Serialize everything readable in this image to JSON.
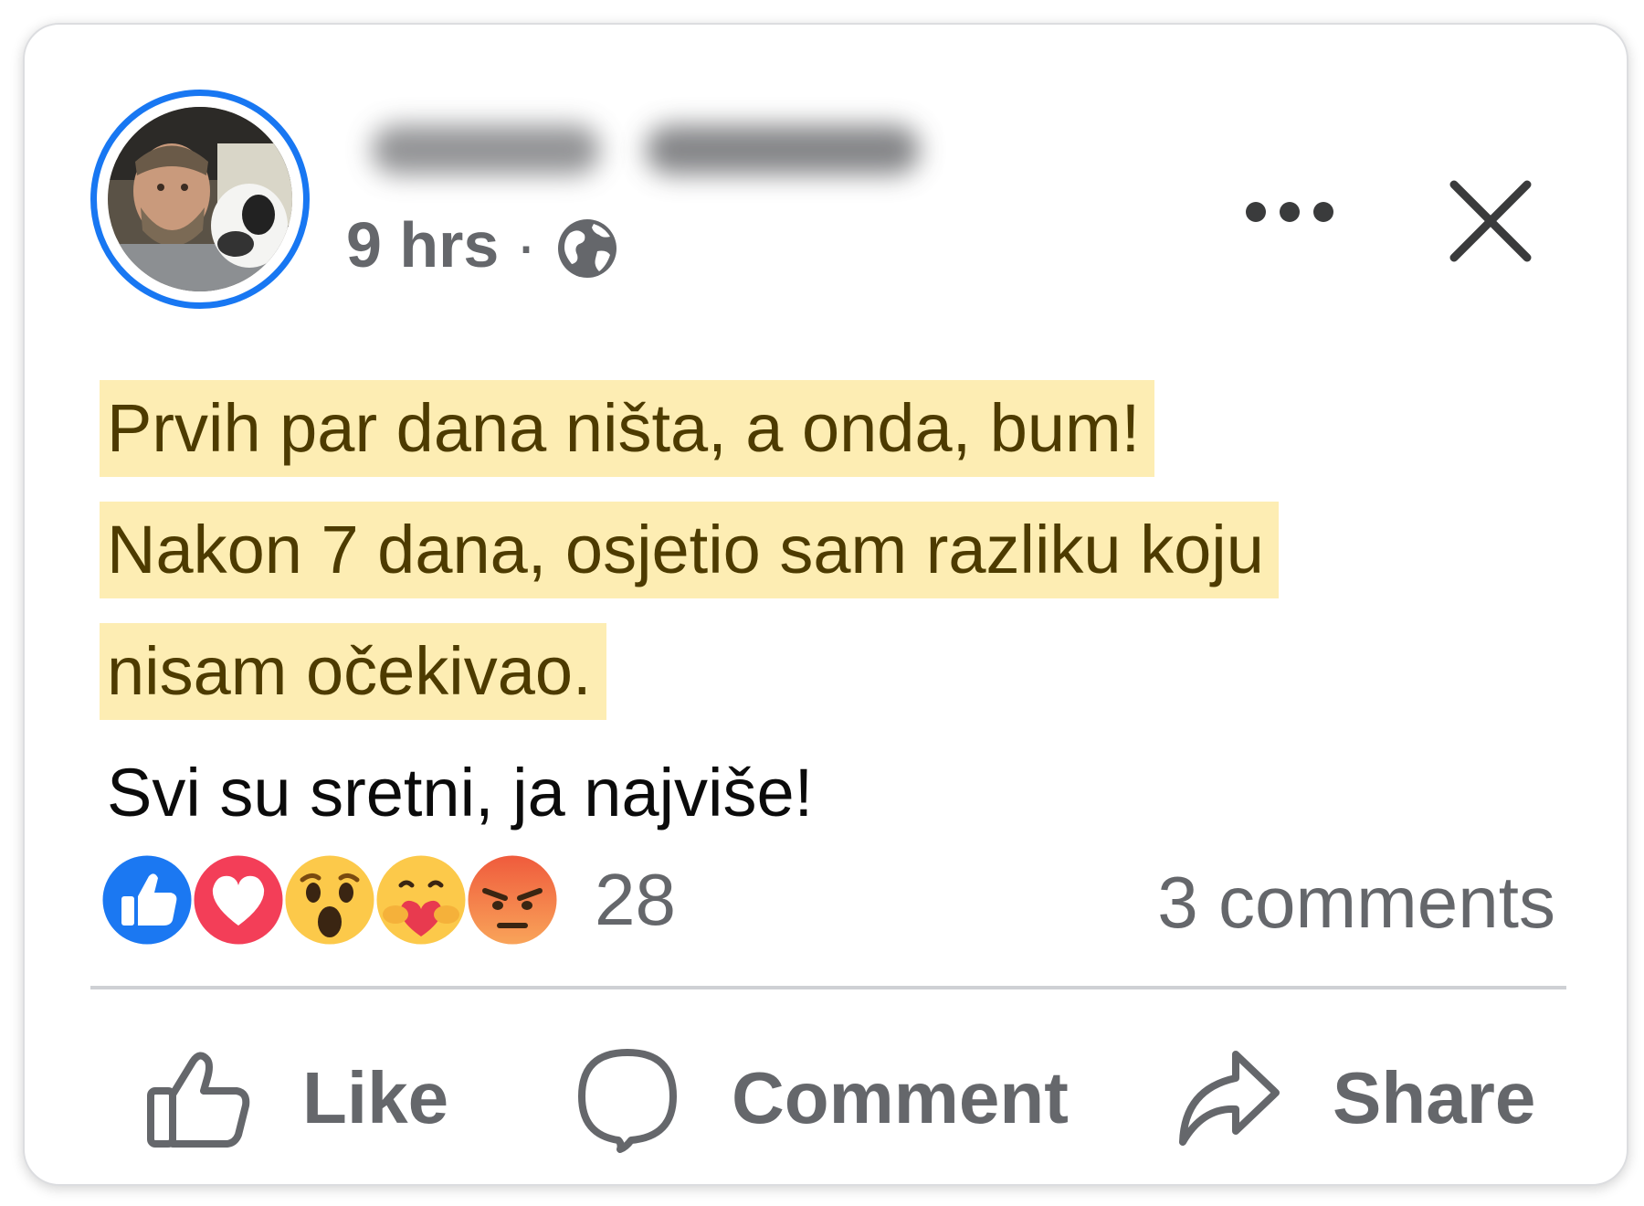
{
  "post": {
    "author_name": "",
    "timestamp": "9 hrs",
    "separator": "·",
    "privacy_icon": "globe-icon",
    "highlighted_lines": [
      "Prvih par dana ništa, a onda, bum!",
      "Nakon 7 dana, osjetio sam razliku koju",
      "nisam očekivao."
    ],
    "plain_line": "Svi su sretni, ja najviše!",
    "highlight_color": "#fdedb3"
  },
  "header_icons": {
    "more": "more-options-icon",
    "close": "close-icon"
  },
  "reactions": {
    "icons": [
      "like-reaction-icon",
      "love-reaction-icon",
      "wow-reaction-icon",
      "care-reaction-icon",
      "angry-reaction-icon"
    ],
    "count": "28"
  },
  "comments": {
    "label": "3 comments"
  },
  "actions": {
    "like_label": "Like",
    "comment_label": "Comment",
    "share_label": "Share"
  },
  "colors": {
    "accent": "#1877f2",
    "secondary_text": "#65676b"
  }
}
